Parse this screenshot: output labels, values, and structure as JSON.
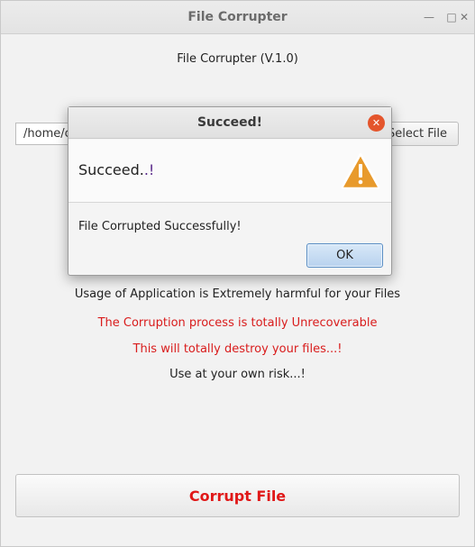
{
  "window": {
    "title": "File Corrupter",
    "minimize_glyph": "—",
    "maximize_glyph": "□",
    "close_glyph": "✕"
  },
  "main": {
    "heading": "File Corrupter (V.1.0)",
    "path_value": "/home/c",
    "select_button_label": "Select File",
    "info_lines": [
      "Usage of Application is Extremely harmful for your Files",
      "The Corruption process is totally Unrecoverable",
      "This will totally destroy your files...!",
      "Use at your own risk...!"
    ],
    "corrupt_button_label": "Corrupt File"
  },
  "dialog": {
    "title": "Succeed!",
    "header_text_main": "Succeed.",
    "header_text_accent": ".!",
    "content_text": "File Corrupted Successfully!",
    "ok_label": "OK",
    "close_glyph": "✕",
    "icon": "warning-icon"
  },
  "colors": {
    "warning_red": "#d91c1c",
    "corrupt_button_text": "#e01818",
    "dialog_close": "#e4552c",
    "ok_button": "#b8d2ee",
    "warning_icon_fill": "#e89a2c"
  }
}
